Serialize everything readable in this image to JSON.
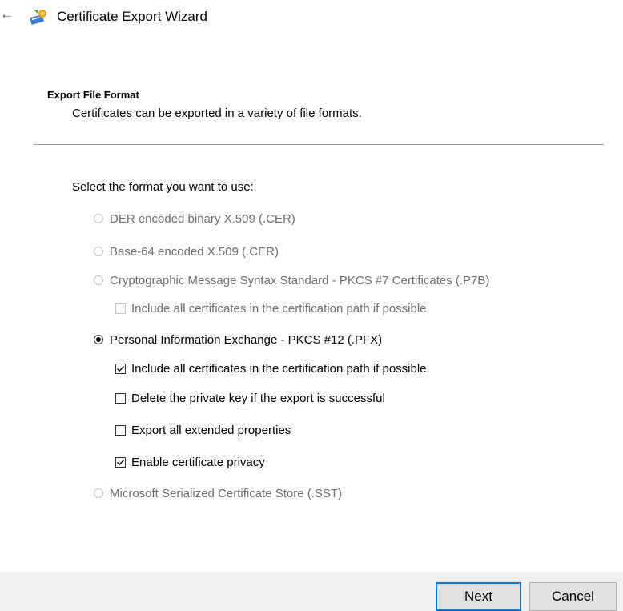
{
  "window": {
    "title": "Certificate Export Wizard",
    "back_icon": "←"
  },
  "header": {
    "title": "Export File Format",
    "subtitle": "Certificates can be exported in a variety of file formats."
  },
  "prompt": "Select the format you want to use:",
  "options": {
    "der": {
      "label": "DER encoded binary X.509 (.CER)",
      "selected": false,
      "enabled": false
    },
    "base64": {
      "label": "Base-64 encoded X.509 (.CER)",
      "selected": false,
      "enabled": false
    },
    "pkcs7": {
      "label": "Cryptographic Message Syntax Standard - PKCS #7 Certificates (.P7B)",
      "selected": false,
      "enabled": false
    },
    "pkcs7_include": {
      "label": "Include all certificates in the certification path if possible",
      "checked": false,
      "enabled": false
    },
    "pfx": {
      "label": "Personal Information Exchange - PKCS #12 (.PFX)",
      "selected": true,
      "enabled": true
    },
    "pfx_include": {
      "label": "Include all certificates in the certification path if possible",
      "checked": true,
      "enabled": true
    },
    "pfx_delete_key": {
      "label": "Delete the private key if the export is successful",
      "checked": false,
      "enabled": true
    },
    "pfx_extended": {
      "label": "Export all extended properties",
      "checked": false,
      "enabled": true
    },
    "pfx_privacy": {
      "label": "Enable certificate privacy",
      "checked": true,
      "enabled": true
    },
    "sst": {
      "label": "Microsoft Serialized Certificate Store (.SST)",
      "selected": false,
      "enabled": false
    }
  },
  "buttons": {
    "next": "Next",
    "cancel": "Cancel"
  },
  "colors": {
    "accent": "#0078d7",
    "disabled_text": "#6d6d6d",
    "footer_bg": "#f0f0f0"
  }
}
